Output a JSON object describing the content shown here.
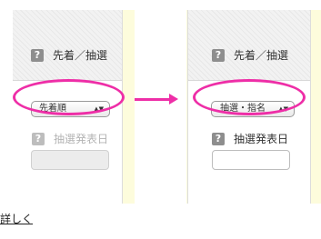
{
  "before": {
    "header_label": "先着／抽選",
    "help_icon": "?",
    "select_value": "先着順",
    "select_arrows": "▲▼",
    "date_label": "抽選発表日",
    "date_input_value": "",
    "date_input_disabled": true
  },
  "after": {
    "header_label": "先着／抽選",
    "help_icon": "?",
    "select_value": "抽選・指名",
    "select_arrows": "▲▼",
    "date_label": "抽選発表日",
    "date_input_value": "",
    "date_input_disabled": false
  },
  "footer": {
    "link_text": "詳しく"
  },
  "colors": {
    "highlight": "#ee2ea7",
    "panel_background": "#fdfcdc",
    "help_badge": "#8e8e8e"
  },
  "icons": {
    "help": "question-mark-icon",
    "transition": "arrow-right-icon"
  }
}
